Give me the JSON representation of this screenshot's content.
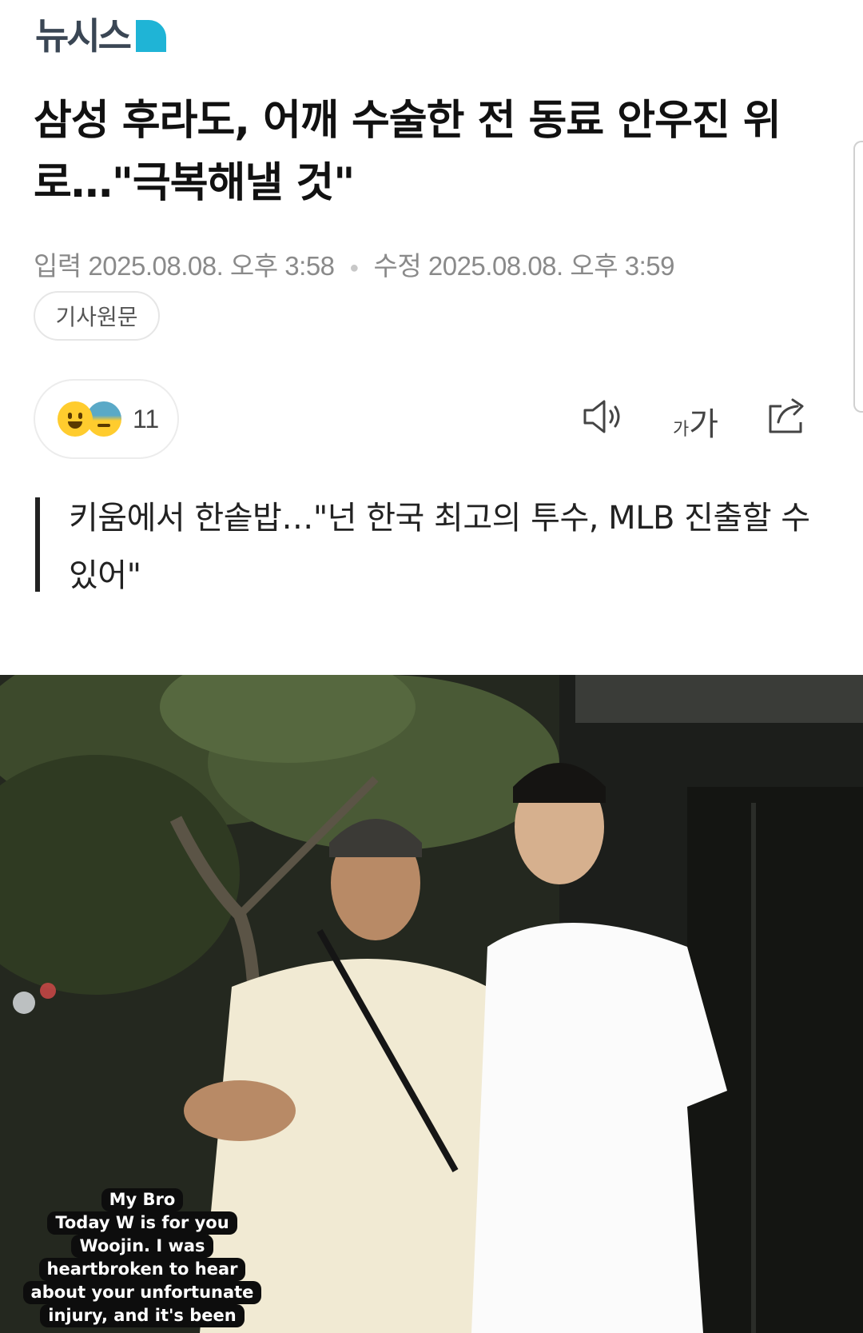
{
  "header": {
    "logo_text": "뉴시스",
    "brand_color": "#1fb4d6"
  },
  "article": {
    "headline": "삼성 후라도, 어깨 수술한 전 동료 안우진 위로…\"극복해낼 것\"",
    "published_label": "입력",
    "published_date": "2025.08.08. 오후 3:58",
    "updated_label": "수정",
    "updated_date": "2025.08.08. 오후 3:59",
    "source_button": "기사원문",
    "subtitle": "키움에서 한솥밥…\"넌 한국 최고의 투수, MLB 진출할 수 있어\""
  },
  "reactions": {
    "count": "11",
    "icons": [
      "smile-emoji",
      "sad-sweat-emoji"
    ]
  },
  "toolbar": {
    "tts_icon": "speaker-icon",
    "font_small": "가",
    "font_large": "가",
    "share_icon": "share-icon"
  },
  "photo": {
    "caption_lines": [
      "My Bro",
      "Today W is for you",
      "Woojin. I was",
      "heartbroken to hear",
      "about your unfortunate",
      "injury, and it's been"
    ]
  }
}
